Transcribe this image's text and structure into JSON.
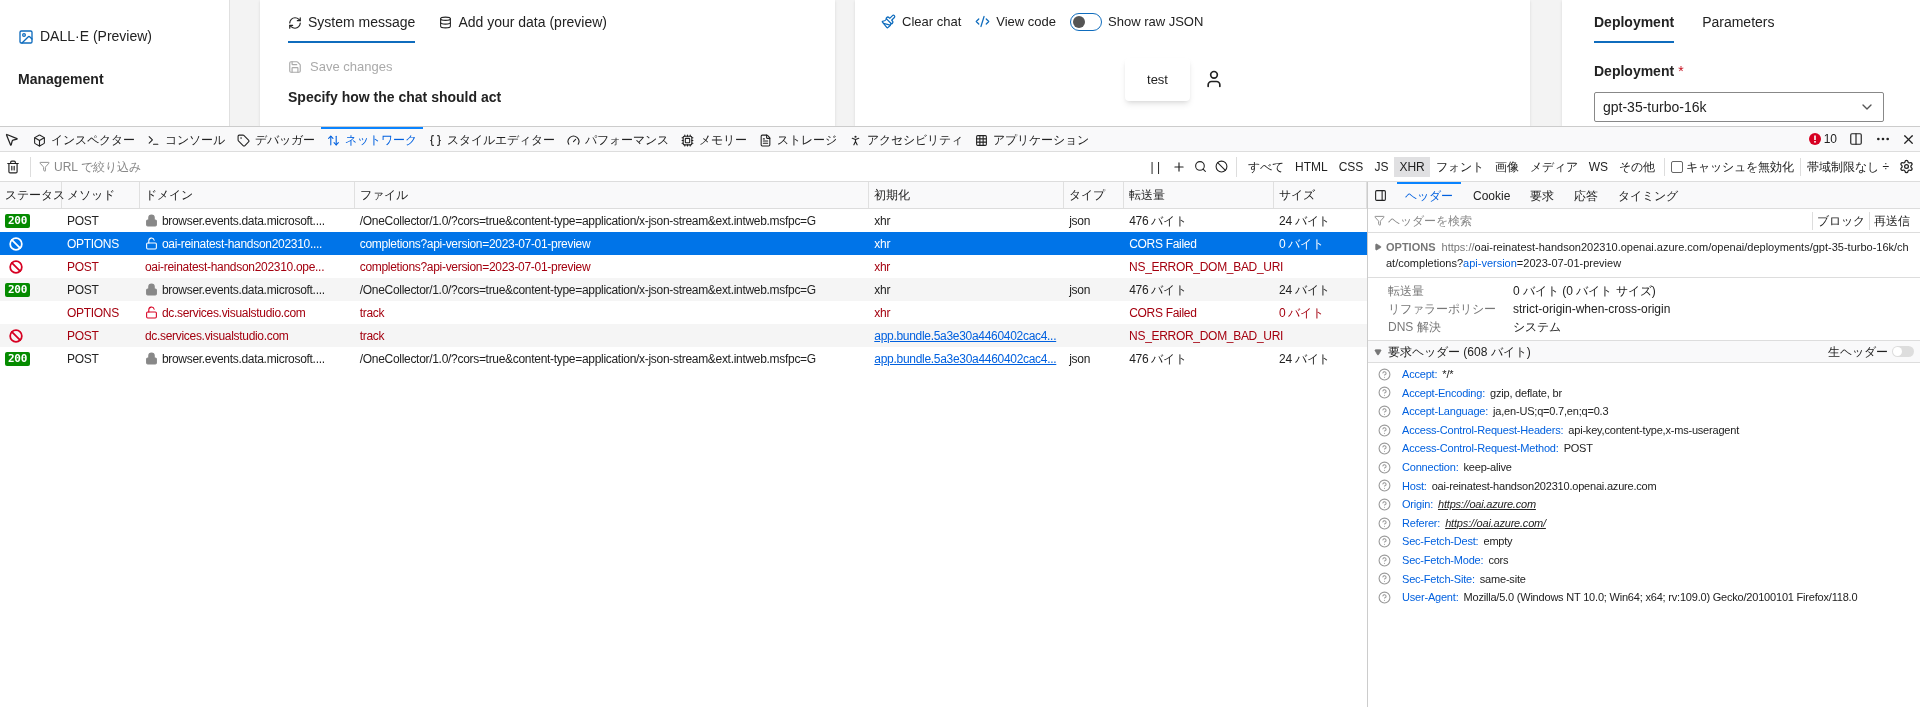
{
  "page": {
    "sidebar": {
      "items": [
        {
          "label": "DALL·E (Preview)"
        }
      ],
      "section": "Management"
    },
    "system_card": {
      "tabs": [
        {
          "label": "System message",
          "selected": true
        },
        {
          "label": "Add your data (preview)",
          "selected": false
        }
      ],
      "save": {
        "label": "Save changes",
        "disabled": true
      },
      "heading": "Specify how the chat should act"
    },
    "chat_card": {
      "toolbar": [
        {
          "label": "Clear chat",
          "kind": "broom"
        },
        {
          "label": "View code",
          "kind": "code"
        }
      ],
      "raw_json": {
        "label": "Show raw JSON",
        "on": false
      },
      "message": "test"
    },
    "config_card": {
      "tabs": [
        {
          "label": "Deployment",
          "selected": true
        },
        {
          "label": "Parameters",
          "selected": false
        }
      ],
      "field_label": "Deployment",
      "required": "*",
      "value": "gpt-35-turbo-16k"
    }
  },
  "devtools": {
    "tabs": [
      {
        "label": "インスペクター",
        "selected": false
      },
      {
        "label": "コンソール",
        "selected": false
      },
      {
        "label": "デバッガー",
        "selected": false
      },
      {
        "label": "ネットワーク",
        "selected": true
      },
      {
        "label": "スタイルエディター",
        "selected": false
      },
      {
        "label": "パフォーマンス",
        "selected": false
      },
      {
        "label": "メモリー",
        "selected": false
      },
      {
        "label": "ストレージ",
        "selected": false
      },
      {
        "label": "アクセシビリティ",
        "selected": false
      },
      {
        "label": "アプリケーション",
        "selected": false
      }
    ],
    "error_count": "10",
    "filter": {
      "placeholder": "URL で絞り込み",
      "pause": "| |",
      "types": [
        {
          "label": "すべて",
          "selected": false
        },
        {
          "label": "HTML",
          "selected": false
        },
        {
          "label": "CSS",
          "selected": false
        },
        {
          "label": "JS",
          "selected": false
        },
        {
          "label": "XHR",
          "selected": true
        },
        {
          "label": "フォント",
          "selected": false
        },
        {
          "label": "画像",
          "selected": false
        },
        {
          "label": "メディア",
          "selected": false
        },
        {
          "label": "WS",
          "selected": false
        },
        {
          "label": "その他",
          "selected": false
        }
      ],
      "disable_cache": {
        "label": "キャッシュを無効化",
        "checked": false
      },
      "throttle": "帯域制限なし ÷"
    },
    "table": {
      "columns": [
        "ステータス",
        "メソッド",
        "ドメイン",
        "ファイル",
        "初期化",
        "タイプ",
        "転送量",
        "サイズ"
      ],
      "rows": [
        {
          "kind": "ok",
          "status": "200",
          "method": "POST",
          "lock": true,
          "broken_lock": false,
          "domain": "browser.events.data.microsoft....",
          "file": "/OneCollector/1.0/?cors=true&content-type=application/x-json-stream&ext.intweb.msfpc=G",
          "initiator": "xhr",
          "initiator_link": false,
          "type": "json",
          "transferred": "476 バイト",
          "size": "24 バイト",
          "selected": false,
          "error": false
        },
        {
          "kind": "blocked",
          "method": "OPTIONS",
          "lock": false,
          "broken_lock": true,
          "domain": "oai-reinatest-handson202310....",
          "file": "completions?api-version=2023-07-01-preview",
          "initiator": "xhr",
          "initiator_link": false,
          "transferred": "CORS Failed",
          "size": "0 バイト",
          "selected": true,
          "error": true
        },
        {
          "kind": "blocked",
          "method": "POST",
          "lock": false,
          "broken_lock": false,
          "domain": "oai-reinatest-handson202310.ope...",
          "file": "completions?api-version=2023-07-01-preview",
          "initiator": "xhr",
          "initiator_link": false,
          "transferred": "NS_ERROR_DOM_BAD_URI",
          "selected": false,
          "error": true
        },
        {
          "kind": "ok",
          "status": "200",
          "method": "POST",
          "lock": true,
          "broken_lock": false,
          "domain": "browser.events.data.microsoft....",
          "file": "/OneCollector/1.0/?cors=true&content-type=application/x-json-stream&ext.intweb.msfpc=G",
          "initiator": "xhr",
          "initiator_link": false,
          "type": "json",
          "transferred": "476 バイト",
          "size": "24 バイト",
          "selected": false,
          "error": false
        },
        {
          "kind": "none",
          "method": "OPTIONS",
          "lock": false,
          "broken_lock": true,
          "domain": "dc.services.visualstudio.com",
          "file": "track",
          "initiator": "xhr",
          "initiator_link": false,
          "transferred": "CORS Failed",
          "size": "0 バイト",
          "selected": false,
          "error": true
        },
        {
          "kind": "blocked",
          "method": "POST",
          "lock": false,
          "broken_lock": false,
          "domain": "dc.services.visualstudio.com",
          "file": "track",
          "initiator": "app.bundle.5a3e30a4460402cac4...",
          "initiator_link": true,
          "transferred": "NS_ERROR_DOM_BAD_URI",
          "selected": false,
          "error": true
        },
        {
          "kind": "ok",
          "status": "200",
          "method": "POST",
          "lock": true,
          "broken_lock": false,
          "domain": "browser.events.data.microsoft....",
          "file": "/OneCollector/1.0/?cors=true&content-type=application/x-json-stream&ext.intweb.msfpc=G",
          "initiator": "app.bundle.5a3e30a4460402cac4...",
          "initiator_link": true,
          "type": "json",
          "transferred": "476 バイト",
          "size": "24 バイト",
          "selected": false,
          "error": false
        }
      ]
    },
    "details": {
      "tabs": [
        {
          "label": "ヘッダー",
          "selected": true
        },
        {
          "label": "Cookie",
          "selected": false
        },
        {
          "label": "要求",
          "selected": false
        },
        {
          "label": "応答",
          "selected": false
        },
        {
          "label": "タイミング",
          "selected": false
        }
      ],
      "filter_placeholder": "ヘッダーを検索",
      "actions": [
        "ブロック",
        "再送信"
      ],
      "request": {
        "method": "OPTIONS",
        "url_prefix": "https://",
        "url_main": "oai-reinatest-handson202310.openai.azure.com/openai/deployments/gpt-35-turbo-16k/chat/completions?",
        "param": "api-version",
        "param_value": "=2023-07-01-preview"
      },
      "summary": [
        {
          "label": "転送量",
          "value": "0 バイト (0 バイト サイズ)"
        },
        {
          "label": "リファラーポリシー",
          "value": "strict-origin-when-cross-origin"
        },
        {
          "label": "DNS 解決",
          "value": "システム"
        }
      ],
      "request_headers": {
        "title": "要求ヘッダー (608 バイト)",
        "expanded": true,
        "raw_label": "生ヘッダー",
        "raw_on": false,
        "items": [
          {
            "name": "Accept:",
            "value": "*/*",
            "kind": "text"
          },
          {
            "name": "Accept-Encoding:",
            "value": "gzip, deflate, br",
            "kind": "text"
          },
          {
            "name": "Accept-Language:",
            "value": "ja,en-US;q=0.7,en;q=0.3",
            "kind": "text"
          },
          {
            "name": "Access-Control-Request-Headers:",
            "value": "api-key,content-type,x-ms-useragent",
            "kind": "text"
          },
          {
            "name": "Access-Control-Request-Method:",
            "value": "POST",
            "kind": "text"
          },
          {
            "name": "Connection:",
            "value": "keep-alive",
            "kind": "text"
          },
          {
            "name": "Host:",
            "value": "oai-reinatest-handson202310.openai.azure.com",
            "kind": "text"
          },
          {
            "name": "Origin:",
            "value": "https://oai.azure.com",
            "kind": "link"
          },
          {
            "name": "Referer:",
            "value": "https://oai.azure.com/",
            "kind": "link"
          },
          {
            "name": "Sec-Fetch-Dest:",
            "value": "empty",
            "kind": "text"
          },
          {
            "name": "Sec-Fetch-Mode:",
            "value": "cors",
            "kind": "text"
          },
          {
            "name": "Sec-Fetch-Site:",
            "value": "same-site",
            "kind": "text"
          },
          {
            "name": "User-Agent:",
            "value": "Mozilla/5.0 (Windows NT 10.0; Win64; x64; rv:109.0) Gecko/20100101 Firefox/118.0",
            "kind": "text"
          }
        ]
      }
    }
  }
}
